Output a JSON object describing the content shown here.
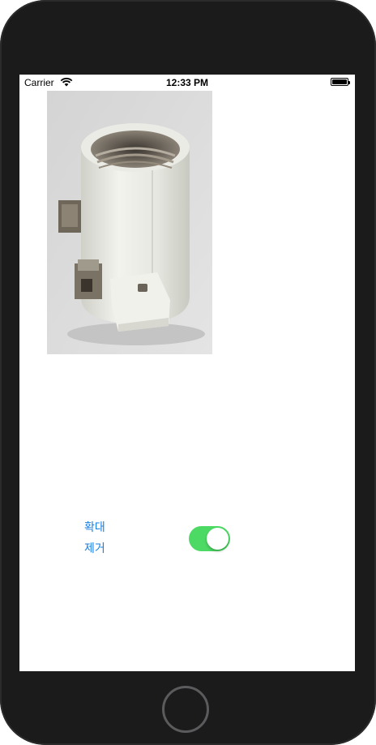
{
  "status_bar": {
    "carrier": "Carrier",
    "time": "12:33 PM",
    "icons": [
      "wifi-icon",
      "battery-icon"
    ]
  },
  "image": {
    "description_icon": "porcelain-lamp-socket-photo"
  },
  "labels": {
    "zoom": "확대",
    "remove": "제거"
  },
  "toggle": {
    "on": true,
    "color": "#4cd964"
  },
  "colors": {
    "label": "#1a7fe0",
    "device": "#1b1b1c"
  }
}
